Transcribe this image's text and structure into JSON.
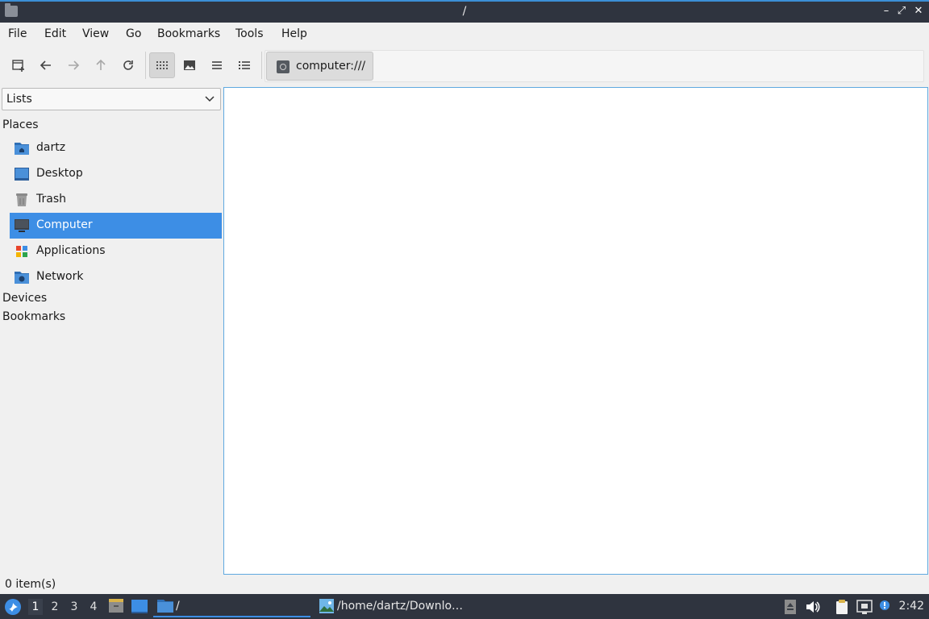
{
  "window": {
    "title": "/",
    "controls": {
      "minimize": "–",
      "maximize": "⤢",
      "close": "✕"
    }
  },
  "menu": [
    "File",
    "Edit",
    "View",
    "Go",
    "Bookmarks",
    "Tools",
    "Help"
  ],
  "toolbar": {
    "buttons": [
      "new-tab-icon",
      "back-icon",
      "forward-icon",
      "up-icon",
      "reload-icon",
      "icon-view-icon",
      "thumbnail-view-icon",
      "compact-view-icon",
      "detailed-list-view-icon"
    ],
    "active_view": "icon-view",
    "path_button": "computer:///"
  },
  "sidebar": {
    "combo_value": "Lists",
    "sections": [
      "Places",
      "Devices",
      "Bookmarks"
    ],
    "places": [
      {
        "label": "dartz",
        "icon": "home-folder-icon"
      },
      {
        "label": "Desktop",
        "icon": "desktop-icon"
      },
      {
        "label": "Trash",
        "icon": "trash-icon"
      },
      {
        "label": "Computer",
        "icon": "computer-icon",
        "selected": true
      },
      {
        "label": "Applications",
        "icon": "applications-icon"
      },
      {
        "label": "Network",
        "icon": "network-folder-icon"
      }
    ]
  },
  "status": {
    "text": "0 item(s)"
  },
  "taskbar": {
    "desktops": [
      "1",
      "2",
      "3",
      "4"
    ],
    "current_desktop": "1",
    "tasks": [
      {
        "label": "/",
        "icon": "folder-icon",
        "active": true
      },
      {
        "label": "/home/dartz/Downlo…",
        "icon": "image-viewer-icon",
        "active": false
      }
    ],
    "clock": "2:42"
  },
  "colors": {
    "titlebar": "#2f343f",
    "accent": "#3d8ee5",
    "selection": "#3d8ee5",
    "taskbar": "#2f343f"
  }
}
